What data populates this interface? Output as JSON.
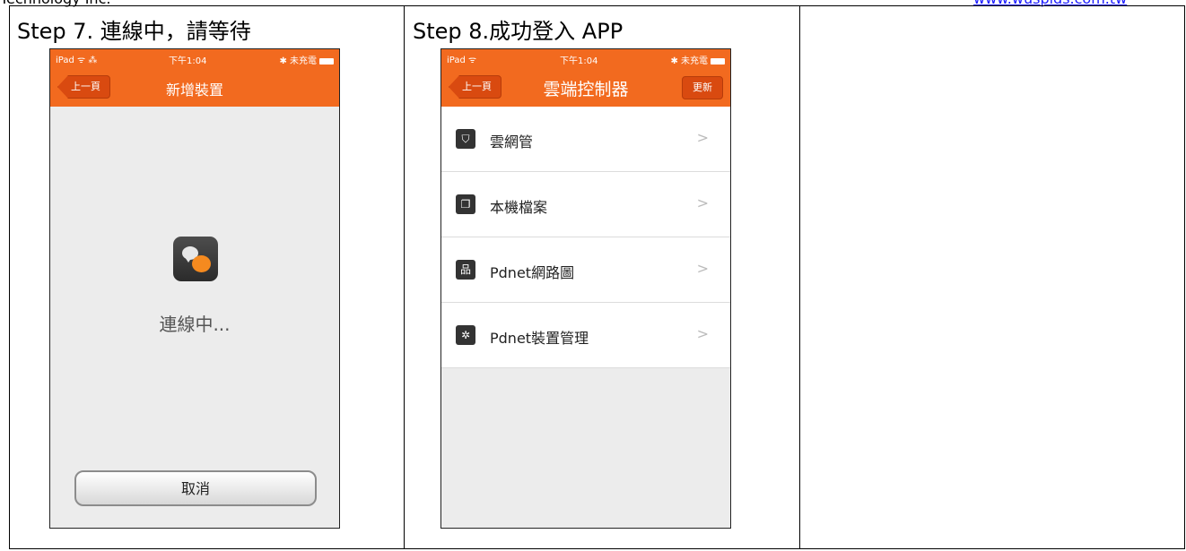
{
  "header": {
    "company": "Technology Inc.",
    "website": "www.wuspids.com.tw"
  },
  "cells": [
    {
      "title": "Step 7. 連線中，請等待"
    },
    {
      "title": "Step 8.成功登入 APP"
    }
  ],
  "phone1": {
    "status": {
      "carrier": "iPad ᯤ ⁂",
      "time": "下午1:04",
      "battery": "✱ 未充電"
    },
    "nav": {
      "back": "上一頁",
      "title": "新增裝置"
    },
    "app_icon": "chat-bubbles-icon",
    "message": "連線中...",
    "cancel": "取消"
  },
  "phone2": {
    "status": {
      "carrier": "iPad ᯤ",
      "time": "下午1:04",
      "battery": "✱ 未充電"
    },
    "nav": {
      "back": "上一頁",
      "title": "雲端控制器",
      "refresh": "更新"
    },
    "menu": [
      {
        "label": "雲網管",
        "icon": "shield-icon",
        "glyph": "⛉"
      },
      {
        "label": "本機檔案",
        "icon": "files-icon",
        "glyph": "❐"
      },
      {
        "label": "Pdnet網路圖",
        "icon": "network-icon",
        "glyph": "品"
      },
      {
        "label": "Pdnet裝置管理",
        "icon": "gear-icon",
        "glyph": "✲"
      }
    ],
    "chevron": ">"
  },
  "colors": {
    "accent": "#f26a1f",
    "button_dark": "#d94a10",
    "link": "#1a1aff"
  }
}
